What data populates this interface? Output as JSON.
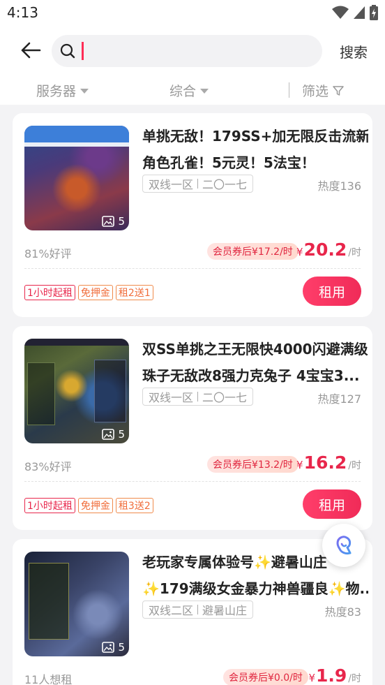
{
  "status": {
    "time": "4:13"
  },
  "search": {
    "placeholder": "",
    "value": "",
    "button": "搜索"
  },
  "filters": {
    "server": "服务器",
    "sort": "综合",
    "filter": "筛选"
  },
  "listings": [
    {
      "title_line1": "单挑无敌！179SS+加无限反击流新",
      "title_line2": "角色孔雀！5元灵！5法宝！",
      "zone": "双线一区",
      "server": "二〇一七",
      "heat": "热度136",
      "image_count": "5",
      "rating": "81%好评",
      "coupon": "会员券后¥17.2/时",
      "price_symbol": "¥",
      "price": "20.2",
      "price_unit": "/时",
      "tags": [
        "1小时起租",
        "免押金",
        "租2送1"
      ],
      "rent": "租用"
    },
    {
      "title_line1": "双SS单挑之王无限快4000闪避满级",
      "title_line2": "珠子无敌改8强力克兔子  4宝宝3...",
      "zone": "双线一区",
      "server": "二〇一七",
      "heat": "热度127",
      "image_count": "5",
      "rating": "83%好评",
      "coupon": "会员券后¥13.2/时",
      "price_symbol": "¥",
      "price": "16.2",
      "price_unit": "/时",
      "tags": [
        "1小时起租",
        "免押金",
        "租3送2"
      ],
      "rent": "租用"
    },
    {
      "title_line1": "老玩家专属体验号✨避暑山庄",
      "title_line2": "✨179满级女金暴力神兽疆良✨物...",
      "zone": "双线二区",
      "server": "避暑山庄",
      "heat": "热度83",
      "image_count": "5",
      "rating": "11人想租",
      "coupon": "会员券后¥0.0/时",
      "price_symbol": "¥",
      "price": "1.9",
      "price_unit": "/时"
    }
  ],
  "colors": {
    "accent": "#e8264b",
    "coupon_bg": "#ffe3e0",
    "page_bg": "#f3f3f5"
  },
  "icons": [
    "back-arrow-icon",
    "search-icon",
    "chevron-down-icon",
    "filter-funnel-icon",
    "image-icon",
    "customer-service-icon",
    "wifi-icon",
    "signal-icon",
    "battery-icon"
  ]
}
